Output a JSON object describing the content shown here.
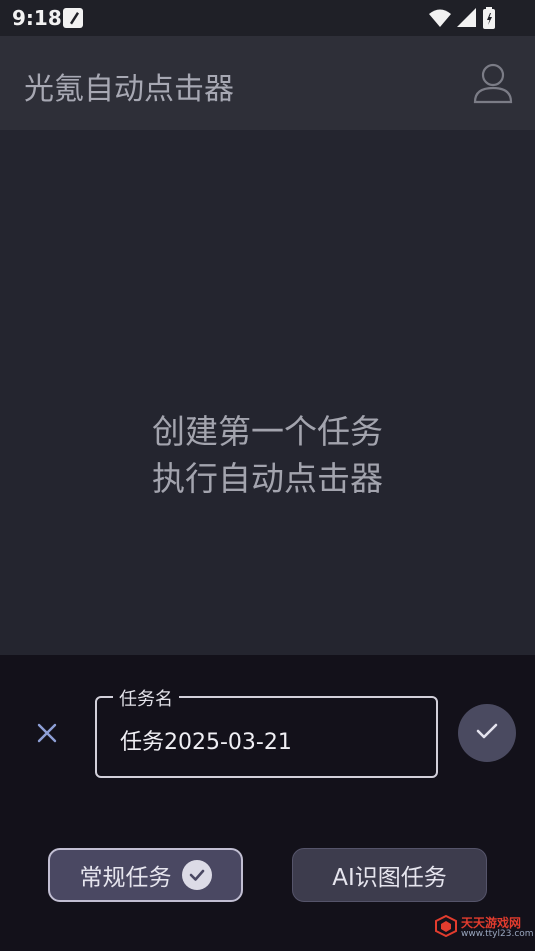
{
  "status_bar": {
    "time": "9:18",
    "icons": [
      "note-icon",
      "wifi-icon",
      "signal-icon",
      "battery-icon"
    ]
  },
  "app_bar": {
    "title": "光氪自动点击器",
    "profile_icon": "person-icon"
  },
  "empty_state": {
    "line1": "创建第一个任务",
    "line2": "执行自动点击器"
  },
  "task_sheet": {
    "field_label": "任务名",
    "field_value": "任务2025-03-21",
    "close_icon": "close-icon",
    "confirm_icon": "check-icon",
    "mode_normal": "常规任务",
    "mode_ai": "AI识图任务",
    "selected_mode": "常规任务"
  },
  "watermark": {
    "brand": "天天游戏网",
    "url": "www.ttyl23.com"
  },
  "colors": {
    "background": "#24252f",
    "app_bar": "#2e2f38",
    "sheet": "#13111a",
    "accent": "#4a4862"
  }
}
